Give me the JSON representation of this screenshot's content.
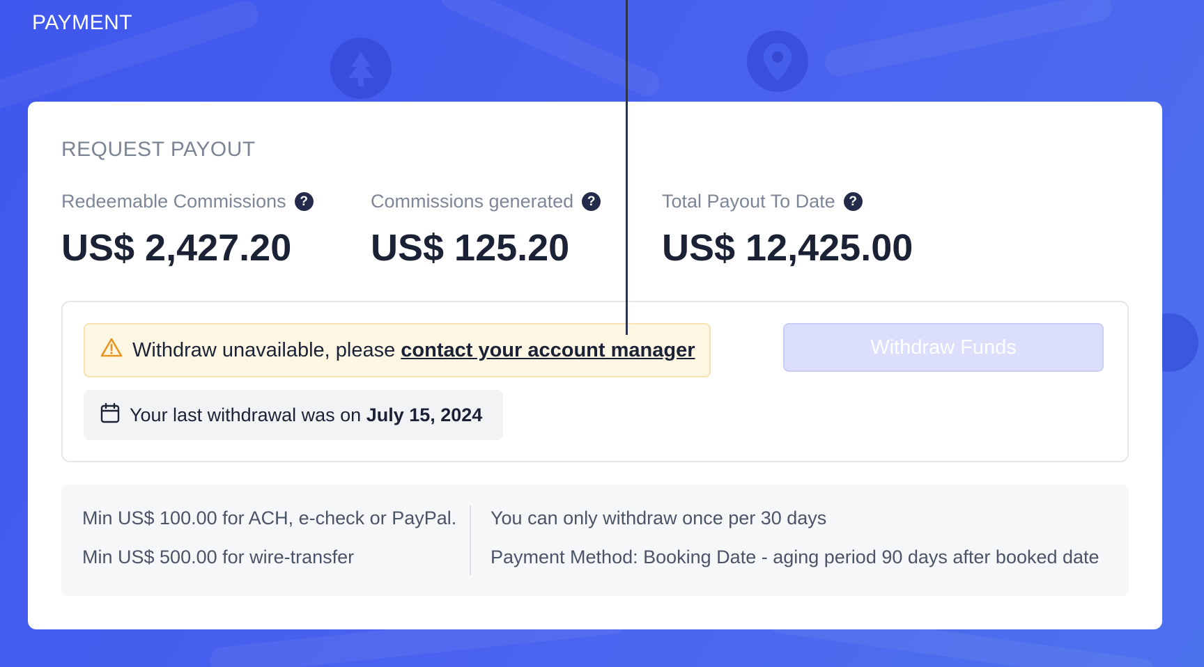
{
  "page": {
    "title": "PAYMENT"
  },
  "card": {
    "heading": "REQUEST PAYOUT",
    "stats": [
      {
        "label": "Redeemable Commissions",
        "value": "US$ 2,427.20"
      },
      {
        "label": "Commissions generated",
        "value": "US$ 125.20"
      },
      {
        "label": "Total Payout To Date",
        "value": "US$ 12,425.00"
      }
    ],
    "help_glyph": "?"
  },
  "withdraw": {
    "alert_text": "Withdraw unavailable, please ",
    "alert_link": "contact your account manager",
    "last_text": "Your last withdrawal was on ",
    "last_date": "July 15, 2024",
    "button_label": "Withdraw Funds"
  },
  "info": {
    "left": [
      "Min US$ 100.00 for ACH, e-check or PayPal.",
      "Min US$ 500.00 for wire-transfer"
    ],
    "right": [
      "You can only withdraw once per 30 days",
      "Payment Method: Booking Date - aging period 90 days after booked date"
    ]
  },
  "icons": {
    "help": "question-circle-icon",
    "alert": "warning-triangle-icon",
    "calendar": "calendar-icon",
    "background": [
      "tree-icon",
      "map-pin-icon"
    ]
  },
  "colors": {
    "background": "#4a63ef",
    "button_disabled": "#dcdffb",
    "alert_bg": "#fdf6e3",
    "alert_icon": "#e8951e"
  }
}
